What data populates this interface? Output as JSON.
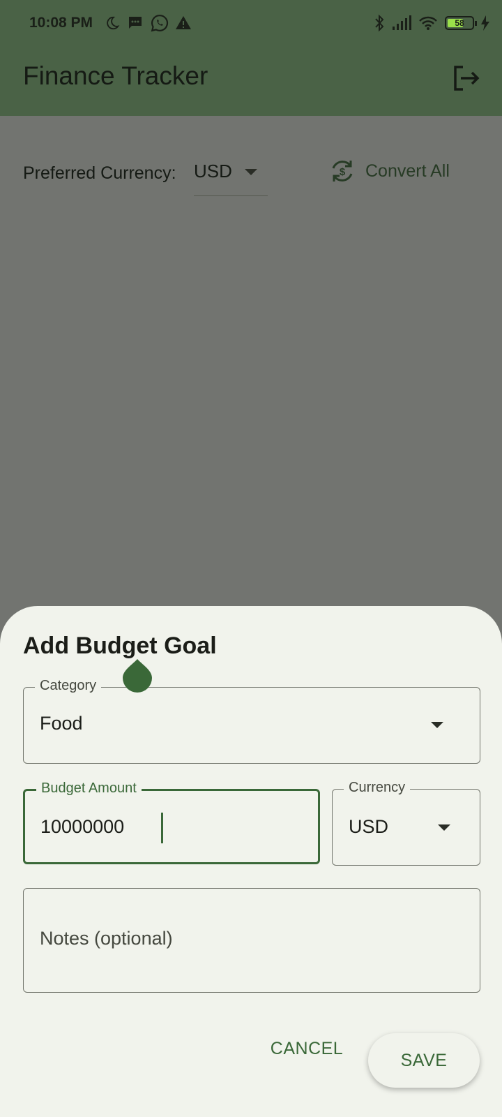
{
  "status_bar": {
    "time": "10:08 PM",
    "battery": "58",
    "left_icons": [
      "moon-icon",
      "message-icon",
      "whatsapp-icon",
      "warning-icon"
    ],
    "right_icons": [
      "bluetooth-icon",
      "signal-icon",
      "wifi-icon",
      "battery-icon",
      "charging-icon"
    ]
  },
  "app_bar": {
    "title": "Finance Tracker",
    "action_icon": "logout-icon"
  },
  "main": {
    "preferred_currency_label": "Preferred Currency:",
    "preferred_currency_value": "USD",
    "convert_all_label": "Convert All"
  },
  "dialog": {
    "title": "Add Budget Goal",
    "category": {
      "label": "Category",
      "value": "Food"
    },
    "budget_amount": {
      "label": "Budget Amount",
      "value": "10000000"
    },
    "currency": {
      "label": "Currency",
      "value": "USD"
    },
    "notes": {
      "placeholder": "Notes (optional)"
    },
    "cancel_label": "CANCEL",
    "save_label": "SAVE"
  },
  "colors": {
    "app_bar": "#4a6246",
    "scrim": "#727470",
    "sheet": "#f1f3ec",
    "accent": "#3a6838"
  }
}
